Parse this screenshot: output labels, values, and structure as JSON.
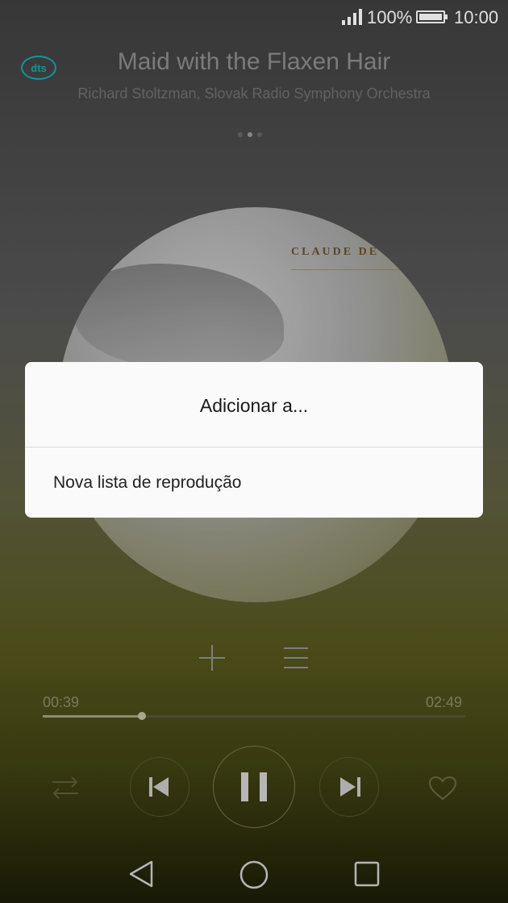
{
  "status_bar": {
    "battery_percent": "100%",
    "time": "10:00",
    "signal_icon": "signal-bars-icon",
    "battery_icon": "battery-full-icon"
  },
  "header": {
    "logo_text": "dts",
    "title": "Maid with the Flaxen Hair",
    "artist": "Richard Stoltzman, Slovak Radio Symphony Orchestra",
    "page_indicator": {
      "count": 3,
      "active_index": 1
    }
  },
  "album_art": {
    "visible_text": "CLAUDE DE"
  },
  "dialog": {
    "title": "Adicionar a...",
    "items": [
      {
        "label": "Nova lista de reprodução"
      }
    ]
  },
  "player": {
    "add_icon": "plus-icon",
    "list_icon": "menu-list-icon",
    "current_time": "00:39",
    "total_time": "02:49",
    "progress_fraction": 0.235,
    "shuffle_icon": "repeat-icon",
    "prev_icon": "skip-previous-icon",
    "play_pause_icon": "pause-icon",
    "next_icon": "skip-next-icon",
    "favorite_icon": "heart-icon"
  },
  "nav_bar": {
    "back_icon": "back-triangle-icon",
    "home_icon": "home-circle-icon",
    "recents_icon": "recents-square-icon"
  },
  "colors": {
    "dts_accent": "#18a7b5",
    "dialog_bg": "#fafafa"
  }
}
